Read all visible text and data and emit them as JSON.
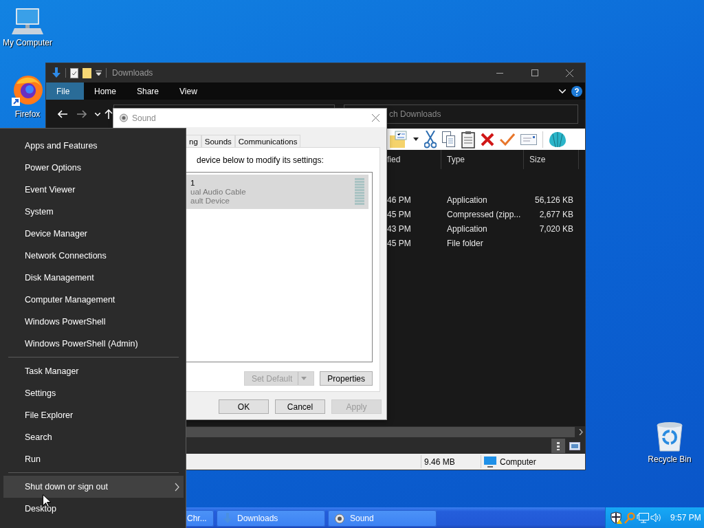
{
  "desktop_icons": [
    {
      "label": "My Computer",
      "kind": "computer"
    },
    {
      "label": "Firefox",
      "kind": "browser"
    },
    {
      "label": "Recycle Bin",
      "kind": "recycle"
    }
  ],
  "explorer": {
    "title": "Downloads",
    "ribbon_tabs": [
      {
        "label": "File",
        "selected": true
      },
      {
        "label": "Home",
        "selected": false
      },
      {
        "label": "Share",
        "selected": false
      },
      {
        "label": "View",
        "selected": false
      }
    ],
    "search": {
      "placeholder": "ch Downloads"
    },
    "columns": [
      "fied",
      "Type",
      "Size"
    ],
    "rows": [
      [
        "46 PM",
        "Application",
        "56,126 KB"
      ],
      [
        "45 PM",
        "Compressed (zipp...",
        "2,677 KB"
      ],
      [
        "43 PM",
        "Application",
        "7,020 KB"
      ],
      [
        "45 PM",
        "File folder",
        ""
      ]
    ],
    "status_bar": {
      "size": "9.46 MB",
      "location": "Computer"
    }
  },
  "sound_dialog": {
    "title": "Sound",
    "tabs": [
      {
        "label": "ng",
        "selected": false
      },
      {
        "label": "Sounds",
        "selected": false
      },
      {
        "label": "Communications",
        "selected": false
      }
    ],
    "instruction": "device below to modify its settings:",
    "devices": [
      {
        "name": "1",
        "description": "ual Audio Cable",
        "status": "ault Device",
        "selected": true
      }
    ],
    "buttons": [
      {
        "label": "Set Default",
        "kind": "split",
        "disabled": true
      },
      {
        "label": "Properties",
        "kind": "plain",
        "disabled": false
      }
    ],
    "footer_buttons": [
      {
        "label": "OK",
        "disabled": false
      },
      {
        "label": "Cancel",
        "disabled": false
      },
      {
        "label": "Apply",
        "disabled": true
      }
    ]
  },
  "context_menu": {
    "groups": [
      [
        {
          "label": "Apps and Features",
          "hovered": false,
          "has_submenu": false
        },
        {
          "label": "Power Options",
          "hovered": false,
          "has_submenu": false
        },
        {
          "label": "Event Viewer",
          "hovered": false,
          "has_submenu": false
        },
        {
          "label": "System",
          "hovered": false,
          "has_submenu": false
        },
        {
          "label": "Device Manager",
          "hovered": false,
          "has_submenu": false
        },
        {
          "label": "Network Connections",
          "hovered": false,
          "has_submenu": false
        },
        {
          "label": "Disk Management",
          "hovered": false,
          "has_submenu": false
        },
        {
          "label": "Computer Management",
          "hovered": false,
          "has_submenu": false
        },
        {
          "label": "Windows PowerShell",
          "hovered": false,
          "has_submenu": false
        },
        {
          "label": "Windows PowerShell (Admin)",
          "hovered": false,
          "has_submenu": false
        }
      ],
      [
        {
          "label": "Task Manager",
          "hovered": false,
          "has_submenu": false
        },
        {
          "label": "Settings",
          "hovered": false,
          "has_submenu": false
        },
        {
          "label": "File Explorer",
          "hovered": false,
          "has_submenu": false
        },
        {
          "label": "Search",
          "hovered": false,
          "has_submenu": false
        },
        {
          "label": "Run",
          "hovered": false,
          "has_submenu": false
        }
      ],
      [
        {
          "label": "Shut down or sign out",
          "hovered": true,
          "has_submenu": true
        },
        {
          "label": "Desktop",
          "hovered": false,
          "has_submenu": false
        }
      ]
    ]
  },
  "taskbar": {
    "buttons": [
      {
        "label": "Chr...",
        "kind": "browser"
      },
      {
        "label": "Downloads",
        "kind": "folder"
      },
      {
        "label": "Sound",
        "kind": "speaker"
      }
    ],
    "clock": "9:57 PM"
  }
}
